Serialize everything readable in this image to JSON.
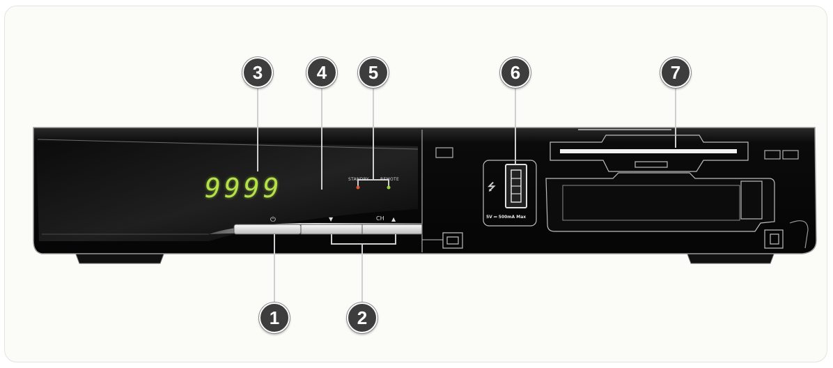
{
  "display": {
    "digits": "9999"
  },
  "labels": {
    "standby": "STANDBY",
    "remote": "REMOTE",
    "channel": "CH",
    "power_glyph": "⏻",
    "down_glyph": "▼",
    "up_glyph": "▲",
    "usb_spec": "5V ⎓ 500mA Max",
    "usb_symbol": "⭍"
  },
  "callouts": [
    {
      "id": "1",
      "text": "1"
    },
    {
      "id": "2",
      "text": "2"
    },
    {
      "id": "3",
      "text": "3"
    },
    {
      "id": "4",
      "text": "4"
    },
    {
      "id": "5",
      "text": "5"
    },
    {
      "id": "6",
      "text": "6"
    },
    {
      "id": "7",
      "text": "7"
    }
  ],
  "colors": {
    "body": "#0d0d0d",
    "led": "#b6e04a",
    "standby_led": "#e0552b",
    "remote_led": "#9ed43a",
    "callout_bg": "#3d3d3d"
  }
}
